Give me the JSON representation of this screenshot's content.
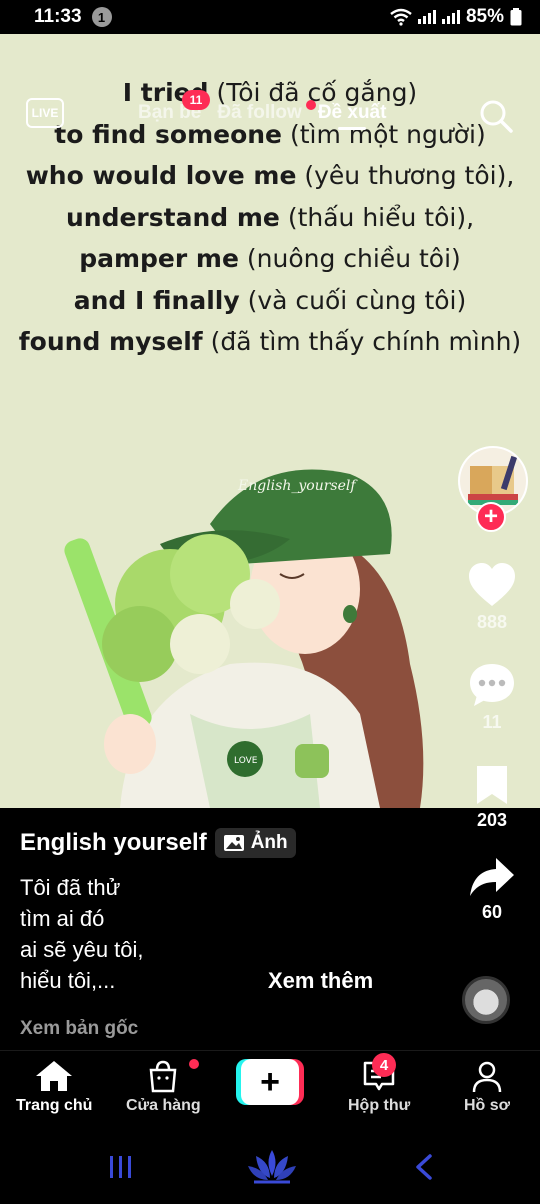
{
  "status_bar": {
    "time": "11:33",
    "notification_count": "1",
    "battery": "85%"
  },
  "top_nav": {
    "live_label": "LIVE",
    "tabs": [
      {
        "label": "Bạn bè",
        "badge": "11"
      },
      {
        "label": "Đã follow",
        "dot": true
      },
      {
        "label": "Đề xuất",
        "active": true
      }
    ]
  },
  "post_image": {
    "quote_lines": [
      {
        "en": "I tried",
        "vi": "(Tôi đã cố gắng)"
      },
      {
        "en": "to find someone",
        "vi": "(tìm một người)"
      },
      {
        "en": "who would love me",
        "vi": "(yêu thương tôi),"
      },
      {
        "en": "understand me",
        "vi": "(thấu hiểu tôi),"
      },
      {
        "en": "pamper me",
        "vi": "(nuông chiều tôi)"
      },
      {
        "en": "and I finally",
        "vi": "(và cuối cùng tôi)"
      },
      {
        "en": "found myself",
        "vi": "(đã tìm thấy chính mình)"
      }
    ],
    "cap_text": "English_yourself",
    "badge_text": "LOVE"
  },
  "rail": {
    "likes": "888",
    "comments": "11",
    "saves": "203",
    "shares": "60"
  },
  "caption": {
    "author": "English yourself",
    "photo_tag": "Ảnh",
    "lines": [
      "Tôi đã thử",
      "tìm ai đó",
      "ai sẽ yêu tôi,",
      "hiểu tôi,..."
    ],
    "see_more": "Xem thêm",
    "see_original": "Xem bản gốc"
  },
  "bottom_nav": {
    "home": "Trang chủ",
    "shop": "Cửa hàng",
    "create": "+",
    "inbox": "Hộp thư",
    "inbox_badge": "4",
    "profile": "Hồ sơ"
  },
  "colors": {
    "accent": "#fe2c55",
    "cyan": "#25f4ee",
    "background": "#e4e9cc"
  }
}
